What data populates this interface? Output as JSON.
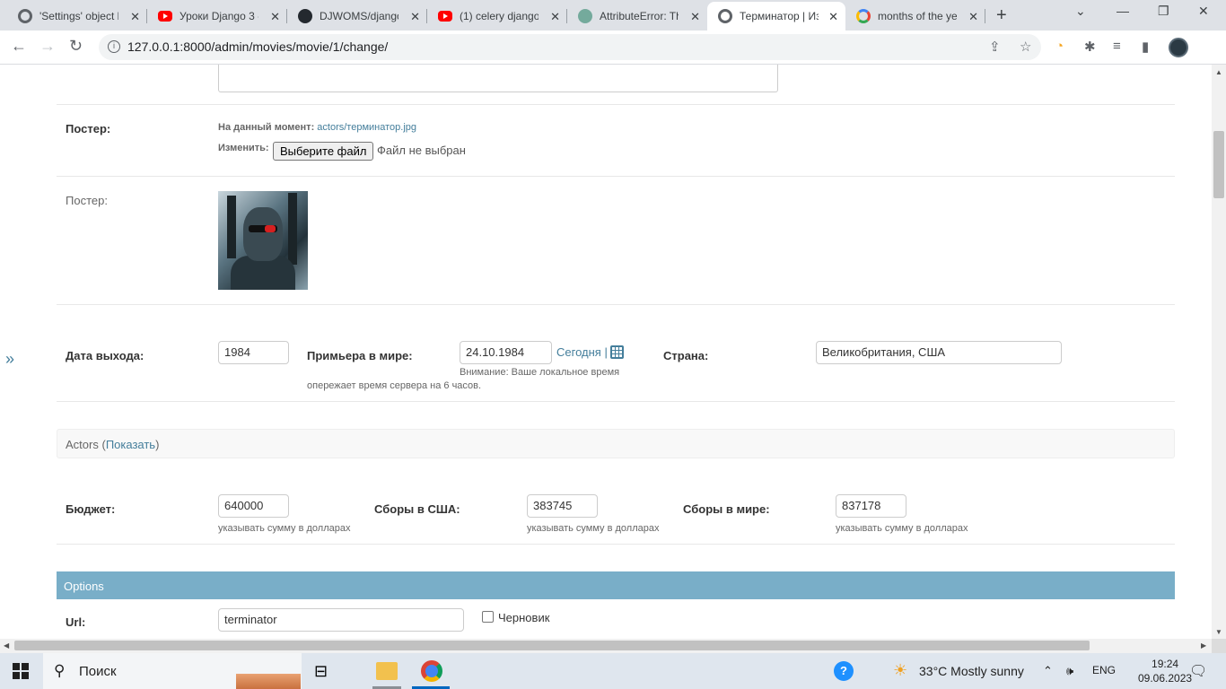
{
  "browser": {
    "tabs": [
      {
        "title": "'Settings' object h",
        "favicon": "globe-icon"
      },
      {
        "title": "Уроки Django 3 -",
        "favicon": "youtube-icon"
      },
      {
        "title": "DJWOMS/django",
        "favicon": "github-icon"
      },
      {
        "title": "(1) celery django",
        "favicon": "youtube-icon"
      },
      {
        "title": "AttributeError: Th",
        "favicon": "chatgpt-icon"
      },
      {
        "title": "Терминатор | Из",
        "favicon": "globe-icon",
        "active": true
      },
      {
        "title": "months of the ye",
        "favicon": "google-icon"
      }
    ],
    "url": "127.0.0.1:8000/admin/movies/movie/1/change/"
  },
  "form": {
    "poster_field": {
      "label": "Постер:",
      "current_label": "На данный момент:",
      "current_file": "actors/терминатор.jpg",
      "change_label": "Изменить:",
      "choose_button": "Выберите файл",
      "no_file": "Файл не выбран"
    },
    "poster_preview": {
      "label": "Постер:"
    },
    "release": {
      "year_label": "Дата выхода:",
      "year_value": "1984",
      "premiere_label": "Примьера в мире:",
      "premiere_value": "24.10.1984",
      "today_link": "Сегодня",
      "separator": "|",
      "tz_warning_line1": "Внимание: Ваше локальное время",
      "tz_warning_line2": "опережает время сервера на 6 часов.",
      "country_label": "Страна:",
      "country_value": "Великобритания, США"
    },
    "actors_fieldset": {
      "title": "Actors",
      "toggle": "Показать",
      "open_paren": "(",
      "close_paren": ")"
    },
    "money": {
      "budget_label": "Бюджет:",
      "budget_value": "640000",
      "usa_label": "Сборы в США:",
      "usa_value": "383745",
      "world_label": "Сборы в мире:",
      "world_value": "837178",
      "help_text": "указывать сумму в долларах"
    },
    "options": {
      "title": "Options",
      "url_label": "Url:",
      "url_value": "terminator",
      "draft_label": "Черновик"
    },
    "sidebar_toggle": "»"
  },
  "taskbar": {
    "search_placeholder": "Поиск",
    "weather": "33°C  Mostly sunny",
    "language": "ENG",
    "time": "19:24",
    "date": "09.06.2023"
  }
}
